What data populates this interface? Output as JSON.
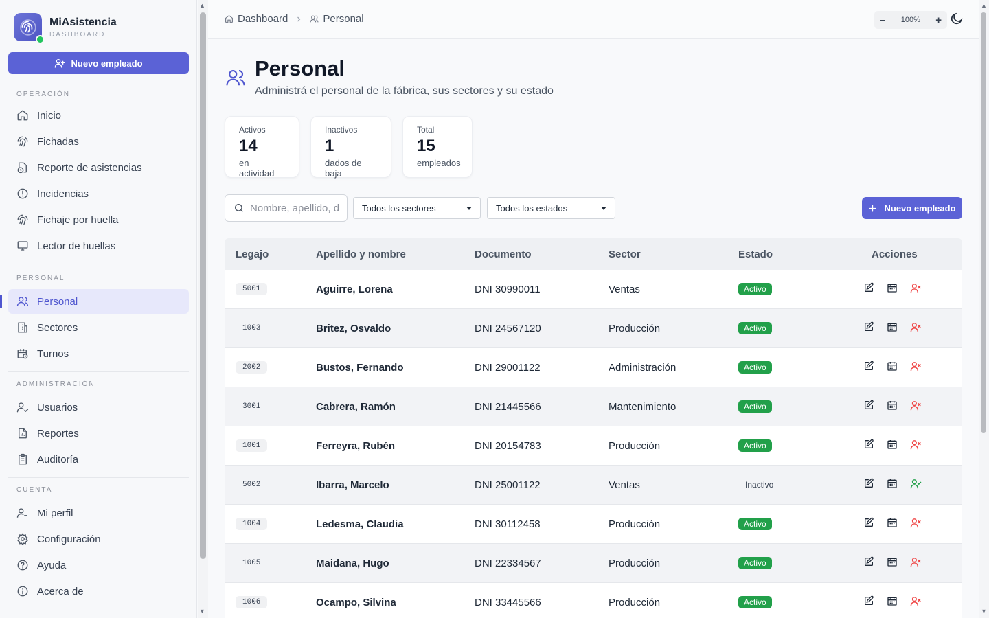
{
  "brand": {
    "name": "MiAsistencia",
    "subtitle": "DASHBOARD"
  },
  "sidebar": {
    "new_button": "Nuevo empleado",
    "sections": [
      {
        "title": "OPERACIÓN",
        "items": [
          {
            "label": "Inicio",
            "icon": "home-icon"
          },
          {
            "label": "Fichadas",
            "icon": "fingerprint-icon"
          },
          {
            "label": "Reporte de asistencias",
            "icon": "clock-file-icon"
          },
          {
            "label": "Incidencias",
            "icon": "alert-circle-icon"
          },
          {
            "label": "Fichaje por huella",
            "icon": "fingerprint-icon"
          },
          {
            "label": "Lector de huellas",
            "icon": "monitor-icon"
          }
        ]
      },
      {
        "title": "PERSONAL",
        "items": [
          {
            "label": "Personal",
            "icon": "users-icon",
            "active": true
          },
          {
            "label": "Sectores",
            "icon": "building-icon"
          },
          {
            "label": "Turnos",
            "icon": "calendar-clock-icon"
          }
        ]
      },
      {
        "title": "ADMINISTRACIÓN",
        "items": [
          {
            "label": "Usuarios",
            "icon": "user-check-icon"
          },
          {
            "label": "Reportes",
            "icon": "file-chart-icon"
          },
          {
            "label": "Auditoría",
            "icon": "clipboard-icon"
          }
        ]
      },
      {
        "title": "CUENTA",
        "items": [
          {
            "label": "Mi perfil",
            "icon": "user-icon"
          },
          {
            "label": "Configuración",
            "icon": "gear-icon"
          },
          {
            "label": "Ayuda",
            "icon": "help-circle-icon"
          },
          {
            "label": "Acerca de",
            "icon": "info-icon"
          }
        ]
      }
    ]
  },
  "topbar": {
    "breadcrumb": [
      "Dashboard",
      "Personal"
    ],
    "zoom": "100%",
    "zoom_minus": "–",
    "zoom_plus": "+"
  },
  "page": {
    "title": "Personal",
    "subtitle": "Administrá el personal de la fábrica, sus sectores y su estado"
  },
  "stats": [
    {
      "label": "Activos",
      "value": "14",
      "desc": "en actividad"
    },
    {
      "label": "Inactivos",
      "value": "1",
      "desc": "dados de baja"
    },
    {
      "label": "Total",
      "value": "15",
      "desc": "empleados"
    }
  ],
  "filters": {
    "search_placeholder": "Nombre, apellido, d",
    "sector_selected": "Todos los sectores",
    "estado_selected": "Todos los estados",
    "new_button": "Nuevo empleado"
  },
  "table": {
    "headers": [
      "Legajo",
      "Apellido y nombre",
      "Documento",
      "Sector",
      "Estado",
      "Acciones"
    ],
    "rows": [
      {
        "legajo": "5001",
        "nombre": "Aguirre, Lorena",
        "documento": "DNI 30990011",
        "sector": "Ventas",
        "estado": "Activo"
      },
      {
        "legajo": "1003",
        "nombre": "Britez, Osvaldo",
        "documento": "DNI 24567120",
        "sector": "Producción",
        "estado": "Activo"
      },
      {
        "legajo": "2002",
        "nombre": "Bustos, Fernando",
        "documento": "DNI 29001122",
        "sector": "Administración",
        "estado": "Activo"
      },
      {
        "legajo": "3001",
        "nombre": "Cabrera, Ramón",
        "documento": "DNI 21445566",
        "sector": "Mantenimiento",
        "estado": "Activo"
      },
      {
        "legajo": "1001",
        "nombre": "Ferreyra, Rubén",
        "documento": "DNI 20154783",
        "sector": "Producción",
        "estado": "Activo"
      },
      {
        "legajo": "5002",
        "nombre": "Ibarra, Marcelo",
        "documento": "DNI 25001122",
        "sector": "Ventas",
        "estado": "Inactivo"
      },
      {
        "legajo": "1004",
        "nombre": "Ledesma, Claudia",
        "documento": "DNI 30112458",
        "sector": "Producción",
        "estado": "Activo"
      },
      {
        "legajo": "1005",
        "nombre": "Maidana, Hugo",
        "documento": "DNI 22334567",
        "sector": "Producción",
        "estado": "Activo"
      },
      {
        "legajo": "1006",
        "nombre": "Ocampo, Silvina",
        "documento": "DNI 33445566",
        "sector": "Producción",
        "estado": "Activo"
      }
    ]
  },
  "colors": {
    "accent": "#5b62d6",
    "active_badge": "#22a04a",
    "deactivate": "#ef4444",
    "activate": "#22a04a"
  }
}
